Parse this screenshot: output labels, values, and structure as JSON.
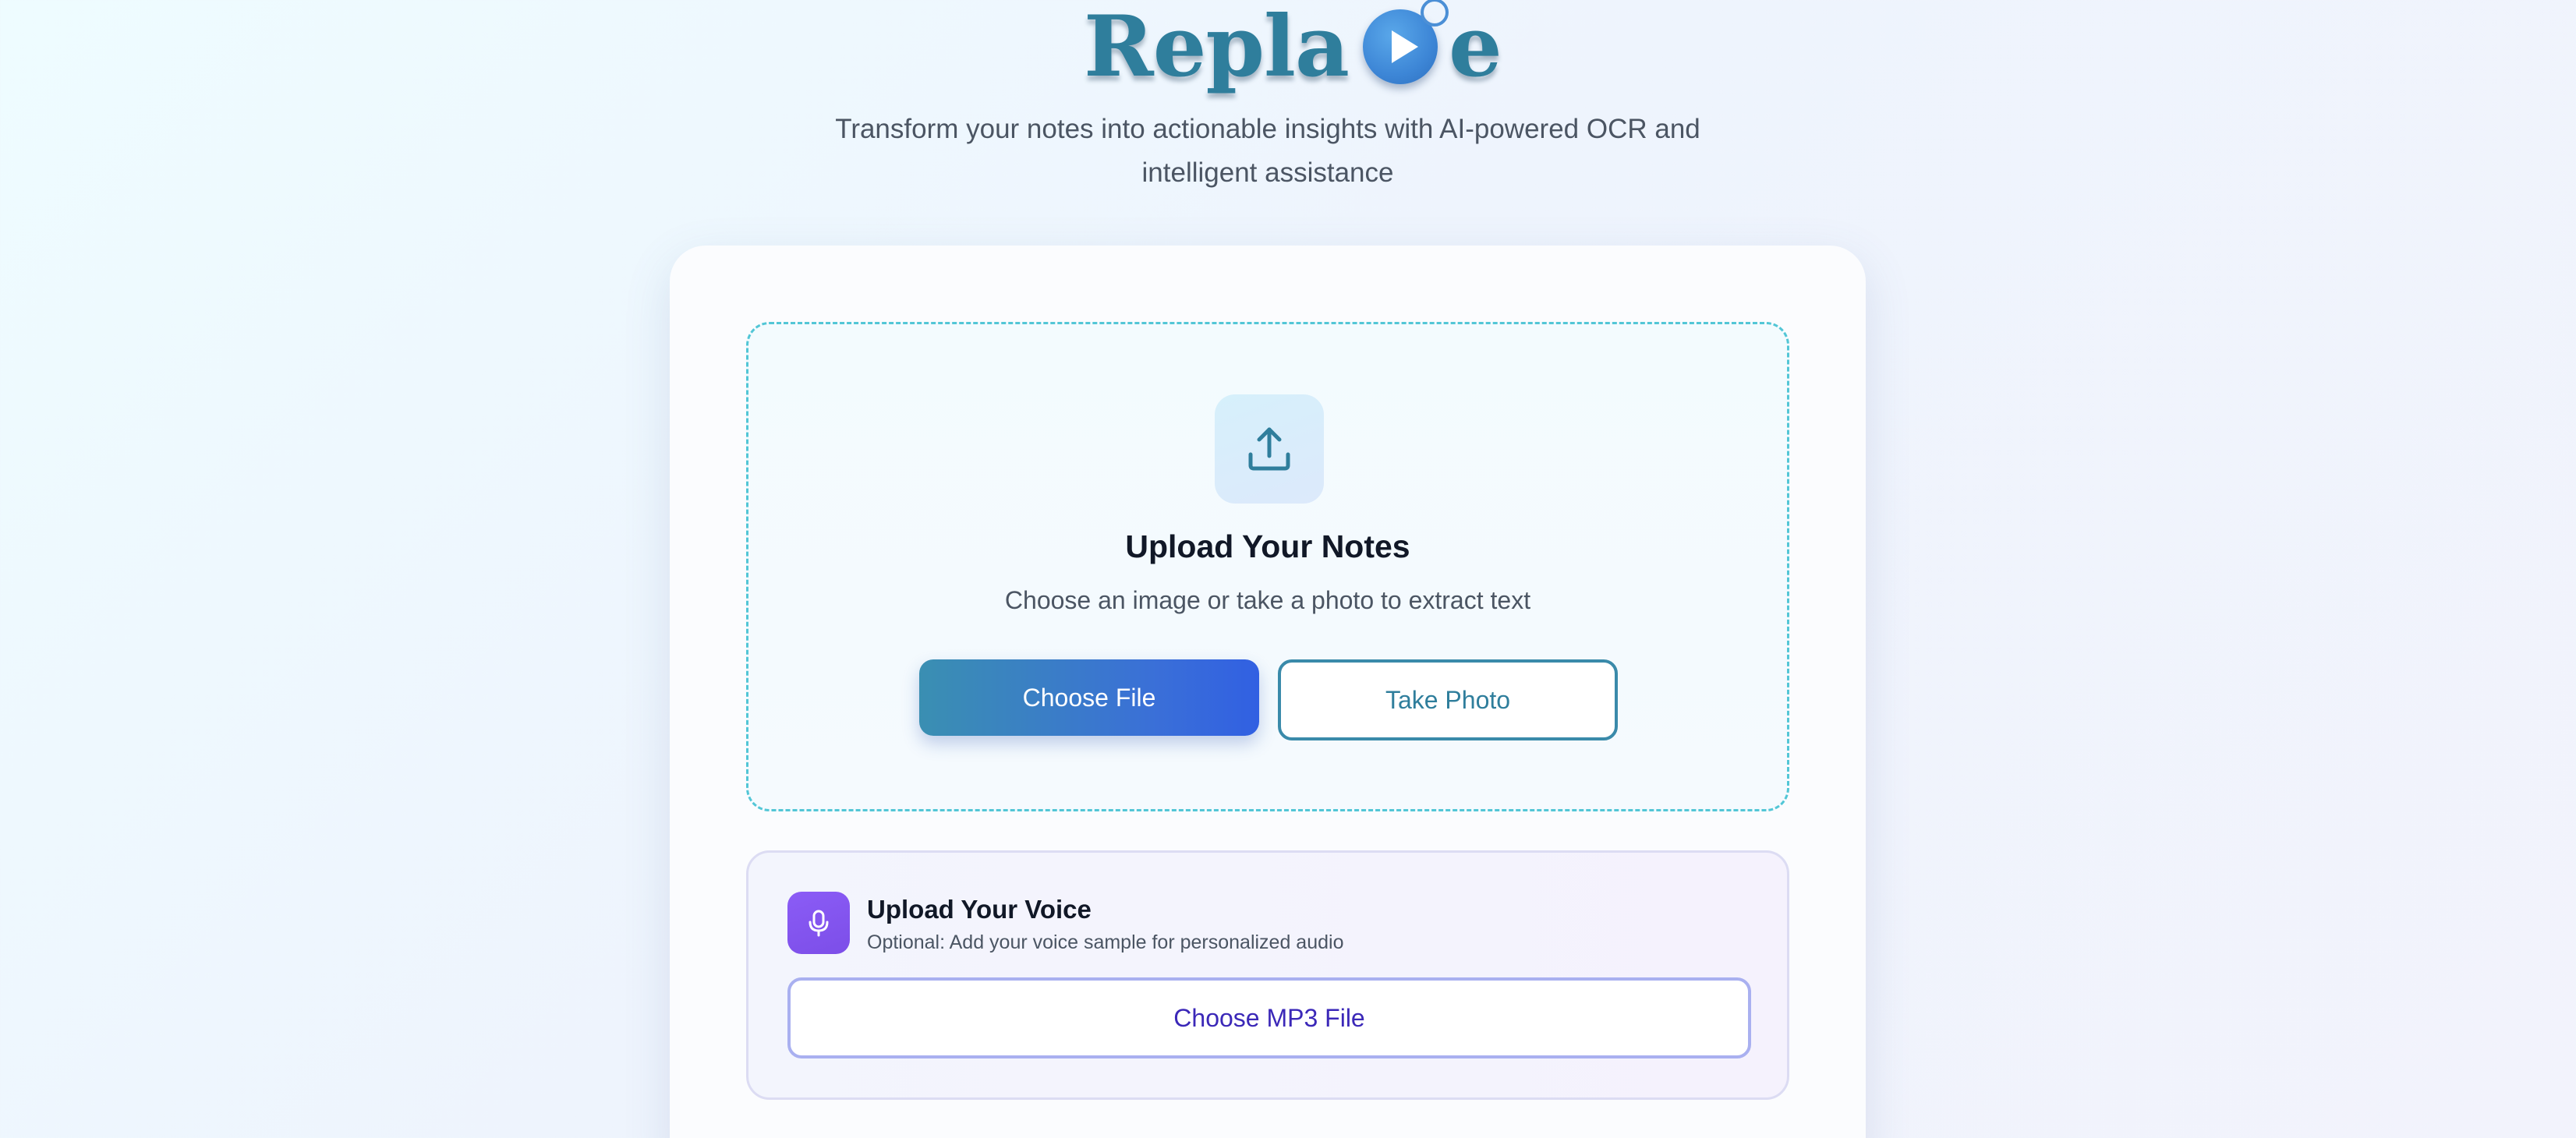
{
  "header": {
    "logo_text_left": "Repla",
    "logo_text_right": "e",
    "logo_icon": "play-icon",
    "tagline": "Transform your notes into actionable insights with AI-powered OCR and intelligent assistance"
  },
  "upload": {
    "icon": "upload-icon",
    "title": "Upload Your Notes",
    "subtitle": "Choose an image or take a photo to extract text",
    "choose_file_label": "Choose File",
    "take_photo_label": "Take Photo"
  },
  "voice": {
    "icon": "microphone-icon",
    "title": "Upload Your Voice",
    "subtitle": "Optional: Add your voice sample for personalized audio",
    "choose_mp3_label": "Choose MP3 File"
  },
  "colors": {
    "brand_teal": "#2f7e9c",
    "primary_blue": "#3a6fd8",
    "dropzone_border": "#52c6d6",
    "voice_purple": "#8b5cf6",
    "mp3_text": "#3b28b8"
  }
}
